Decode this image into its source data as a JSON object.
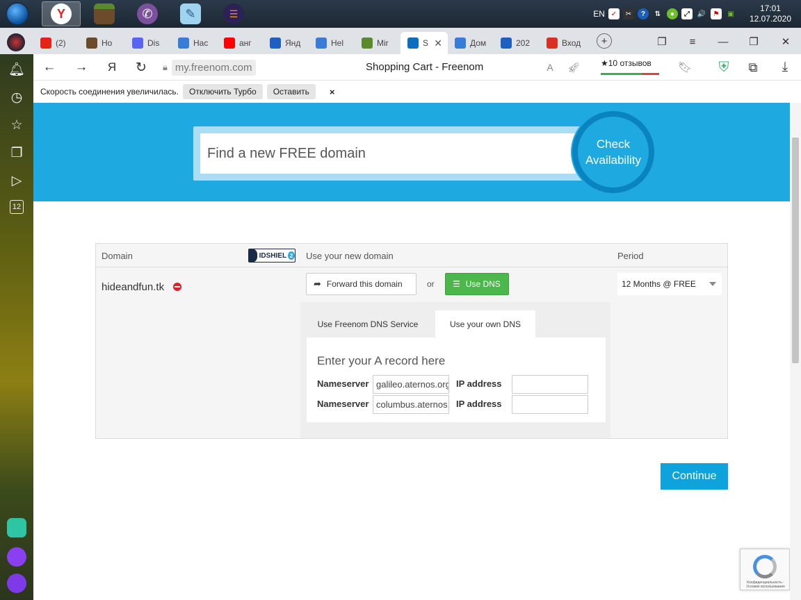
{
  "taskbar": {
    "language": "EN",
    "time": "17:01",
    "date": "12.07.2020"
  },
  "tabs": [
    {
      "label": "(2)",
      "fav_color": "#e62117"
    },
    {
      "label": "Ho",
      "fav_color": "#6b4b2a"
    },
    {
      "label": "Dis",
      "fav_color": "#5865f2"
    },
    {
      "label": "Нас",
      "fav_color": "#3a7bd5"
    },
    {
      "label": "анг",
      "fav_color": "#ff0000"
    },
    {
      "label": "Янд",
      "fav_color": "#1f5fbf"
    },
    {
      "label": "Hel",
      "fav_color": "#3a7bd5"
    },
    {
      "label": "Mir",
      "fav_color": "#5a8a2a"
    },
    {
      "label": "S",
      "fav_color": "#0a6ebd",
      "active": true
    },
    {
      "label": "Дом",
      "fav_color": "#3a7bd5"
    },
    {
      "label": "202",
      "fav_color": "#1f5fbf"
    },
    {
      "label": "Вход",
      "fav_color": "#d93025"
    }
  ],
  "browser": {
    "url": "my.freenom.com",
    "page_title": "Shopping Cart - Freenom",
    "reviews": "★10 отзывов"
  },
  "turbo_bar": {
    "message": "Скорость соединения увеличилась.",
    "disable_label": "Отключить Турбо",
    "keep_label": "Оставить",
    "close_label": "×"
  },
  "sidebar": {
    "badge_number": "12"
  },
  "hero": {
    "search_placeholder": "Find a new FREE domain",
    "check_label_line1": "Check",
    "check_label_line2": "Availability"
  },
  "cart": {
    "col_domain": "Domain",
    "col_use": "Use your new domain",
    "col_period": "Period",
    "idshield_text": "IDSHIEL",
    "idshield_badge": "2",
    "domain_name": "hideandfun.tk",
    "forward_label": "Forward this domain",
    "or_label": "or",
    "use_dns_label": "Use DNS",
    "period_value": "12 Months @ FREE",
    "dns_tabs": [
      "Use Freenom DNS Service",
      "Use your own DNS"
    ],
    "dns_heading": "Enter your A record here",
    "nameserver_label": "Nameserver",
    "ip_label": "IP address",
    "nameservers": [
      "galileo.aternos.org",
      "columbus.aternos.org"
    ]
  },
  "continue_label": "Continue",
  "recaptcha_text": "Конфиденциальность - Условия использования",
  "colors": {
    "freenom_blue": "#1fa9e1",
    "use_dns_green": "#4cb84c",
    "continue_blue": "#0ea3dc"
  }
}
